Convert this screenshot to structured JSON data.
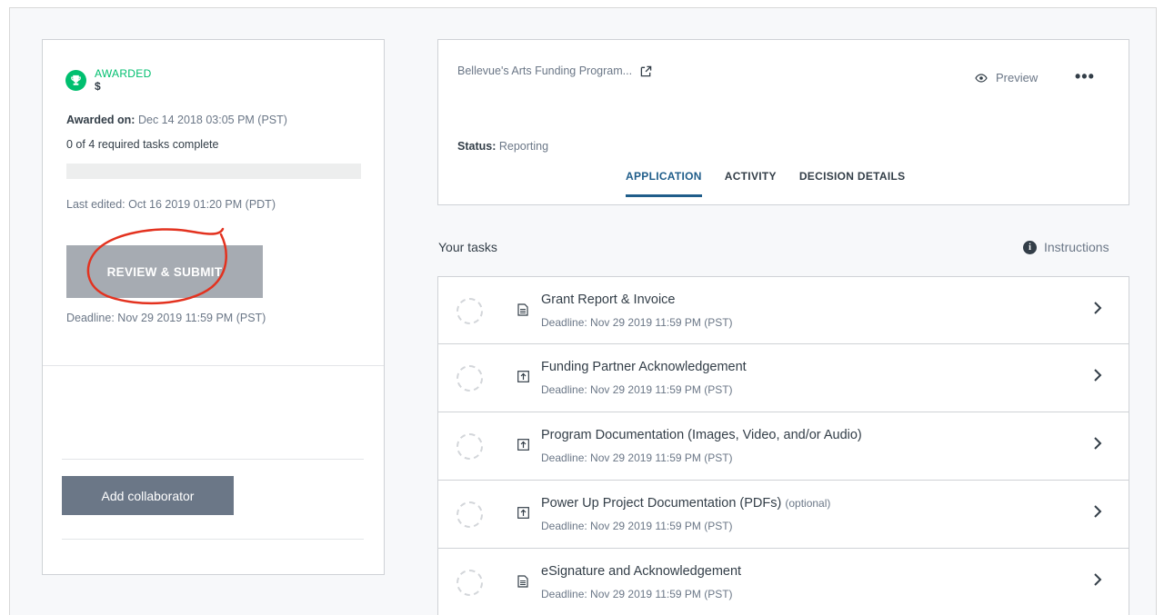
{
  "left": {
    "status_label": "AWARDED",
    "amount": "$",
    "awarded_on_label": "Awarded on:",
    "awarded_on_value": "Dec 14 2018 03:05 PM (PST)",
    "tasks_complete": "0 of 4 required tasks complete",
    "progress": 0,
    "last_edited": "Last edited: Oct 16 2019 01:20 PM (PDT)",
    "review_button": "REVIEW & SUBMIT",
    "deadline": "Deadline: Nov 29 2019 11:59 PM (PST)",
    "collaborator_button": "Add collaborator"
  },
  "header": {
    "program_title": "Bellevue's Arts Funding Program...",
    "preview_label": "Preview",
    "more_label": "•••",
    "status_label": "Status:",
    "status_value": "Reporting",
    "tabs": [
      {
        "label": "APPLICATION",
        "active": true
      },
      {
        "label": "ACTIVITY",
        "active": false
      },
      {
        "label": "DECISION DETAILS",
        "active": false
      }
    ]
  },
  "tasks_section": {
    "title": "Your tasks",
    "instructions_label": "Instructions",
    "info_glyph": "i",
    "items": [
      {
        "name": "Grant Report & Invoice",
        "optional": "",
        "deadline": "Deadline: Nov 29 2019 11:59 PM (PST)",
        "icon": "document-icon"
      },
      {
        "name": "Funding Partner Acknowledgement",
        "optional": "",
        "deadline": "Deadline: Nov 29 2019 11:59 PM (PST)",
        "icon": "upload-icon"
      },
      {
        "name": "Program Documentation (Images, Video, and/or Audio)",
        "optional": "",
        "deadline": "Deadline: Nov 29 2019 11:59 PM (PST)",
        "icon": "upload-icon"
      },
      {
        "name": "Power Up Project Documentation (PDFs)",
        "optional": "(optional)",
        "deadline": "Deadline: Nov 29 2019 11:59 PM (PST)",
        "icon": "upload-icon"
      },
      {
        "name": "eSignature and Acknowledgement",
        "optional": "",
        "deadline": "Deadline: Nov 29 2019 11:59 PM (PST)",
        "icon": "document-icon"
      }
    ]
  },
  "colors": {
    "accent_green": "#00bf6f",
    "tab_active": "#1f5d8a",
    "annotation_red": "#e3321f"
  }
}
